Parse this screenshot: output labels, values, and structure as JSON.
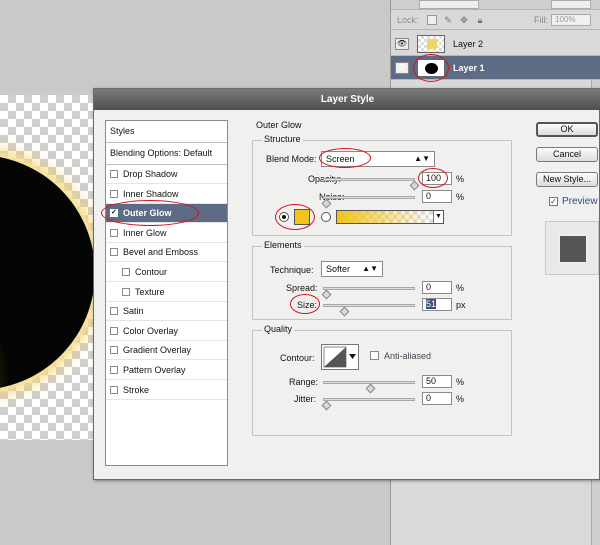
{
  "layers_panel": {
    "lock_label": "Lock:",
    "fill_label": "Fill:",
    "fill_value": "100%",
    "layers": [
      {
        "name": "Layer 2"
      },
      {
        "name": "Layer 1"
      }
    ]
  },
  "dialog": {
    "title": "Layer Style",
    "styles": {
      "header": "Styles",
      "blending": "Blending Options: Default",
      "items": [
        {
          "label": "Drop Shadow",
          "checked": false
        },
        {
          "label": "Inner Shadow",
          "checked": false
        },
        {
          "label": "Outer Glow",
          "checked": true,
          "selected": true
        },
        {
          "label": "Inner Glow",
          "checked": false
        },
        {
          "label": "Bevel and Emboss",
          "checked": false
        },
        {
          "label": "Contour",
          "checked": false,
          "indent": true
        },
        {
          "label": "Texture",
          "checked": false,
          "indent": true
        },
        {
          "label": "Satin",
          "checked": false
        },
        {
          "label": "Color Overlay",
          "checked": false
        },
        {
          "label": "Gradient Overlay",
          "checked": false
        },
        {
          "label": "Pattern Overlay",
          "checked": false
        },
        {
          "label": "Stroke",
          "checked": false
        }
      ]
    },
    "outer_glow": {
      "title": "Outer Glow",
      "structure": {
        "title": "Structure",
        "blend_mode_label": "Blend Mode:",
        "blend_mode_value": "Screen",
        "opacity_label": "Opacity:",
        "opacity_value": "100",
        "opacity_pos": 1.0,
        "noise_label": "Noise:",
        "noise_value": "0",
        "noise_pos": 0.0,
        "unit_percent": "%",
        "glow_color": "#f0c419"
      },
      "elements": {
        "title": "Elements",
        "technique_label": "Technique:",
        "technique_value": "Softer",
        "spread_label": "Spread:",
        "spread_value": "0",
        "spread_pos": 0.0,
        "size_label": "Size:",
        "size_value": "51",
        "size_pos": 0.2,
        "unit_px": "px"
      },
      "quality": {
        "title": "Quality",
        "contour_label": "Contour:",
        "anti_aliased_label": "Anti-aliased",
        "range_label": "Range:",
        "range_value": "50",
        "range_pos": 0.5,
        "jitter_label": "Jitter:",
        "jitter_value": "0",
        "jitter_pos": 0.0
      }
    },
    "buttons": {
      "ok": "OK",
      "cancel": "Cancel",
      "new_style": "New Style...",
      "preview_label": "Preview"
    }
  },
  "colors": {
    "selection": "#5d6b85",
    "annotation": "#d8101a",
    "glow": "#f0c419"
  }
}
